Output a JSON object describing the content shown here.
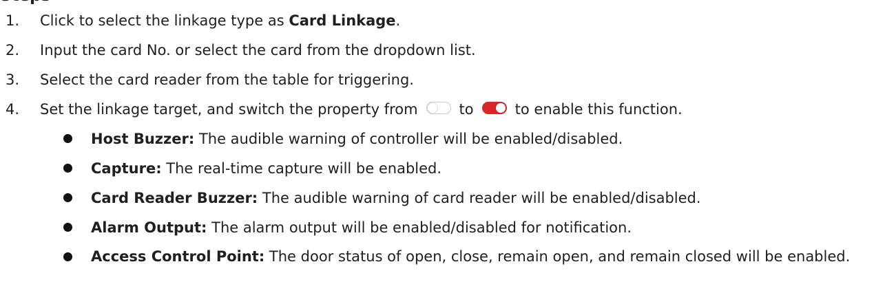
{
  "heading_cut": "Steps",
  "steps": [
    {
      "num": "1.",
      "pre": "Click to select the linkage type as ",
      "bold": "Card Linkage",
      "post": "."
    },
    {
      "num": "2.",
      "text": "Input the card No. or select the card from the dropdown list."
    },
    {
      "num": "3.",
      "text": "Select the card reader from the table for triggering."
    },
    {
      "num": "4.",
      "pre": "Set the linkage target, and switch the property from",
      "mid": "to",
      "post": "to enable this function."
    }
  ],
  "toggles": {
    "off_icon": "toggle-off-icon",
    "on_icon": "toggle-on-icon",
    "on_color": "#d9262b"
  },
  "bullets": [
    {
      "term": "Host Buzzer:",
      "desc": " The audible warning of controller will be enabled/disabled."
    },
    {
      "term": "Capture:",
      "desc": " The real-time capture will be enabled."
    },
    {
      "term": "Card Reader Buzzer:",
      "desc": " The audible warning of card reader will be enabled/disabled."
    },
    {
      "term": "Alarm Output:",
      "desc": " The alarm output will be enabled/disabled for notification."
    },
    {
      "term": "Access Control Point:",
      "desc": " The door status of open, close, remain open, and remain closed will be enabled."
    }
  ]
}
